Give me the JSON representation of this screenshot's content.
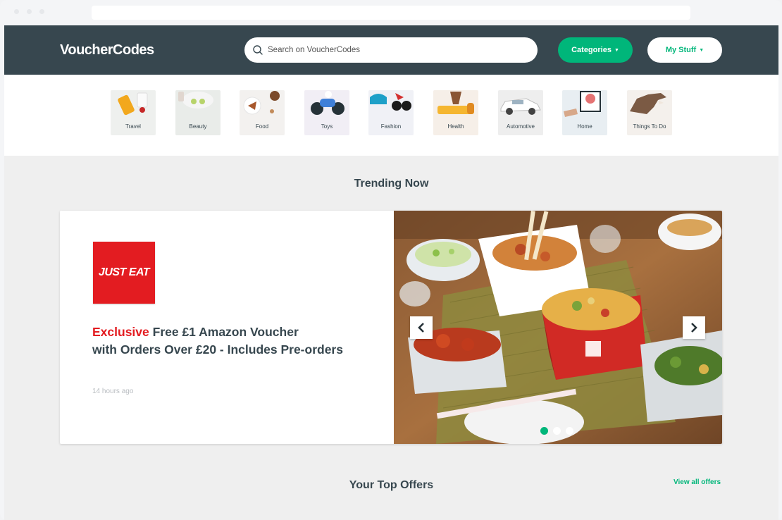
{
  "header": {
    "logo": "VoucherCodes",
    "search_placeholder": "Search on VoucherCodes",
    "categories_label": "Categories",
    "mystuff_label": "My Stuff"
  },
  "categories": [
    {
      "label": "Travel",
      "icon": "travel-icon"
    },
    {
      "label": "Beauty",
      "icon": "beauty-icon"
    },
    {
      "label": "Food",
      "icon": "food-icon"
    },
    {
      "label": "Toys",
      "icon": "toys-icon"
    },
    {
      "label": "Fashion",
      "icon": "fashion-icon"
    },
    {
      "label": "Health",
      "icon": "health-icon"
    },
    {
      "label": "Automotive",
      "icon": "automotive-icon"
    },
    {
      "label": "Home",
      "icon": "home-icon"
    },
    {
      "label": "Things To Do",
      "icon": "things-to-do-icon"
    }
  ],
  "trending": {
    "title": "Trending Now",
    "merchant": "JUST EAT",
    "offer_exclusive": "Exclusive",
    "offer_line1": "Free £1 Amazon Voucher",
    "offer_line2": "with Orders Over £20 - Includes Pre-orders",
    "time": "14 hours ago",
    "slides": 3,
    "active_slide": 1
  },
  "top_offers": {
    "title": "Your Top Offers",
    "view_all": "View all offers"
  },
  "colors": {
    "header_bg": "#37474f",
    "accent_green": "#00b67a",
    "brand_red": "#e31c21",
    "page_bg": "#efefef"
  }
}
